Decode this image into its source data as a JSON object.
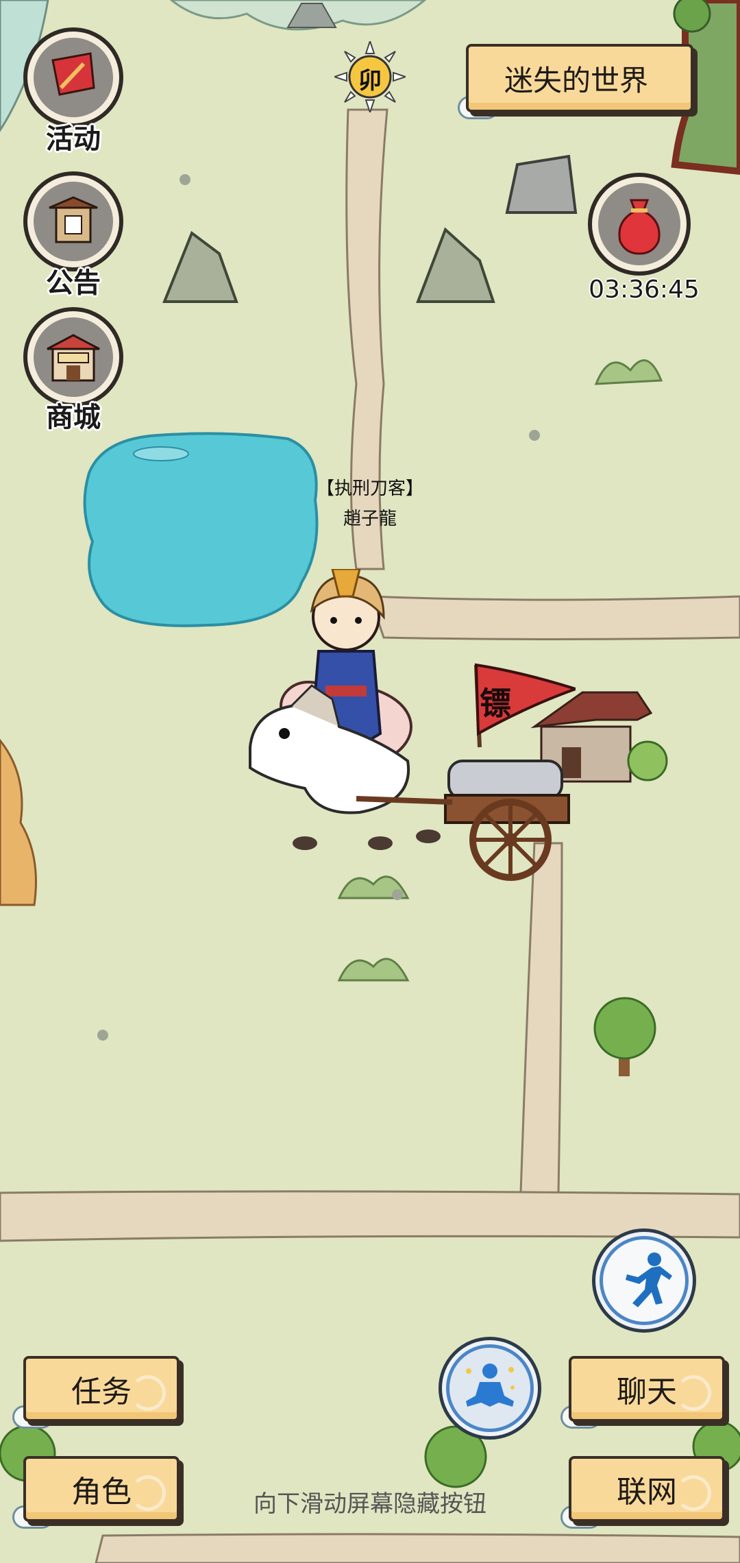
{
  "world": {
    "title": "迷失的世界"
  },
  "sun_badge": {
    "char": "卯"
  },
  "left_menu": [
    {
      "label": "活动",
      "icon": "banner-sword-icon"
    },
    {
      "label": "公告",
      "icon": "notice-board-icon"
    },
    {
      "label": "商城",
      "icon": "shop-icon"
    }
  ],
  "red_bag": {
    "icon": "red-lucky-bag-icon",
    "timer": "03:36:45"
  },
  "npc": {
    "title": "【执刑刀客】",
    "name": "趙子龍"
  },
  "escort": {
    "flag_char": "镖"
  },
  "bottom_left": {
    "quest": "任务",
    "character": "角色"
  },
  "bottom_right": {
    "chat": "聊天",
    "network": "联网"
  },
  "hint": "向下滑动屏幕隐藏按钮",
  "colors": {
    "grass": "#dfe6c1",
    "road": "#e5d8bf",
    "lake": "#56c8d6",
    "button": "#f8d99a"
  }
}
